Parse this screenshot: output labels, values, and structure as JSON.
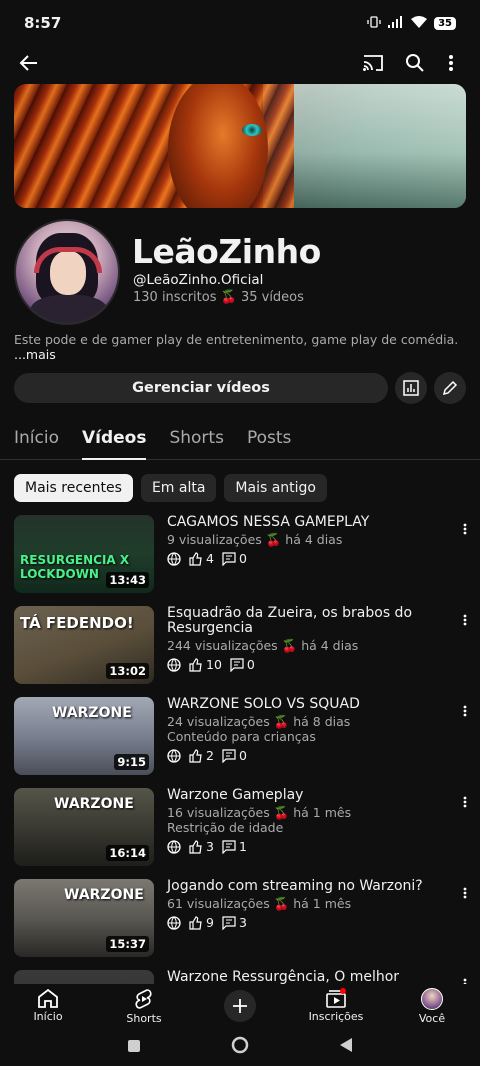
{
  "status_bar": {
    "time": "8:57",
    "battery": "35"
  },
  "app_bar": {
    "back_icon": "arrow-left-icon",
    "cast_icon": "cast-icon",
    "search_icon": "search-icon",
    "more_icon": "more-vert-icon"
  },
  "channel": {
    "name": "LeãoZinho",
    "handle": "@LeãoZinho.Oficial",
    "stats": "130 inscritos 🍒 35 vídeos",
    "description": "Este pode e de gamer play de entretenimento, game play de comédia.",
    "more_label": "...mais",
    "manage_label": "Gerenciar vídeos"
  },
  "tabs": [
    {
      "label": "Início",
      "active": false
    },
    {
      "label": "Vídeos",
      "active": true
    },
    {
      "label": "Shorts",
      "active": false
    },
    {
      "label": "Posts",
      "active": false
    }
  ],
  "chips": [
    {
      "label": "Mais recentes",
      "active": true
    },
    {
      "label": "Em alta",
      "active": false
    },
    {
      "label": "Mais antigo",
      "active": false
    }
  ],
  "videos": [
    {
      "title": "CAGAMOS NESSA GAMEPLAY",
      "meta": "9 visualizações 🍒 há 4 dias",
      "flag": "",
      "likes": "4",
      "comments": "0",
      "duration": "13:43",
      "thumb_text": "RESURGENCIA X LOCKDOWN",
      "thumb_color": "#1f3d2a"
    },
    {
      "title": "Esquadrão da Zueira, os brabos do Resurgencia",
      "meta": "244 visualizações 🍒 há 4 dias",
      "flag": "",
      "likes": "10",
      "comments": "0",
      "duration": "13:02",
      "thumb_text": "TÁ FEDENDO!",
      "thumb_color": "#5a4e3a"
    },
    {
      "title": "WARZONE SOLO VS SQUAD",
      "meta": "24 visualizações 🍒 há 8 dias",
      "flag": "Conteúdo para crianças",
      "likes": "2",
      "comments": "0",
      "duration": "9:15",
      "thumb_text": "WARZONE",
      "thumb_color": "#7a8090"
    },
    {
      "title": "Warzone Gameplay",
      "meta": "16 visualizações 🍒 há 1 mês",
      "flag": "Restrição de idade",
      "likes": "3",
      "comments": "1",
      "duration": "16:14",
      "thumb_text": "WARZONE",
      "thumb_color": "#3a3a32"
    },
    {
      "title": "Jogando com streaming no Warzoni?",
      "meta": "61 visualizações 🍒 há 1 mês",
      "flag": "",
      "likes": "9",
      "comments": "3",
      "duration": "15:37",
      "thumb_text": "WARZONE",
      "thumb_color": "#5a5852"
    },
    {
      "title": "Warzone Ressurgência, O melhor Squa...",
      "meta": "",
      "flag": "",
      "likes": "",
      "comments": "",
      "duration": "",
      "thumb_text": "",
      "thumb_color": "#2a2a2a"
    }
  ],
  "bottom_nav": [
    {
      "label": "Início",
      "icon": "home-icon"
    },
    {
      "label": "Shorts",
      "icon": "shorts-icon"
    },
    {
      "label": "",
      "icon": "create-icon"
    },
    {
      "label": "Inscrições",
      "icon": "subscriptions-icon"
    },
    {
      "label": "Você",
      "icon": "you-avatar-icon"
    }
  ],
  "colors": {
    "background": "#0f0f0f",
    "surface": "#272727",
    "text": "#f1f1f1",
    "secondary_text": "#aaaaaa"
  }
}
